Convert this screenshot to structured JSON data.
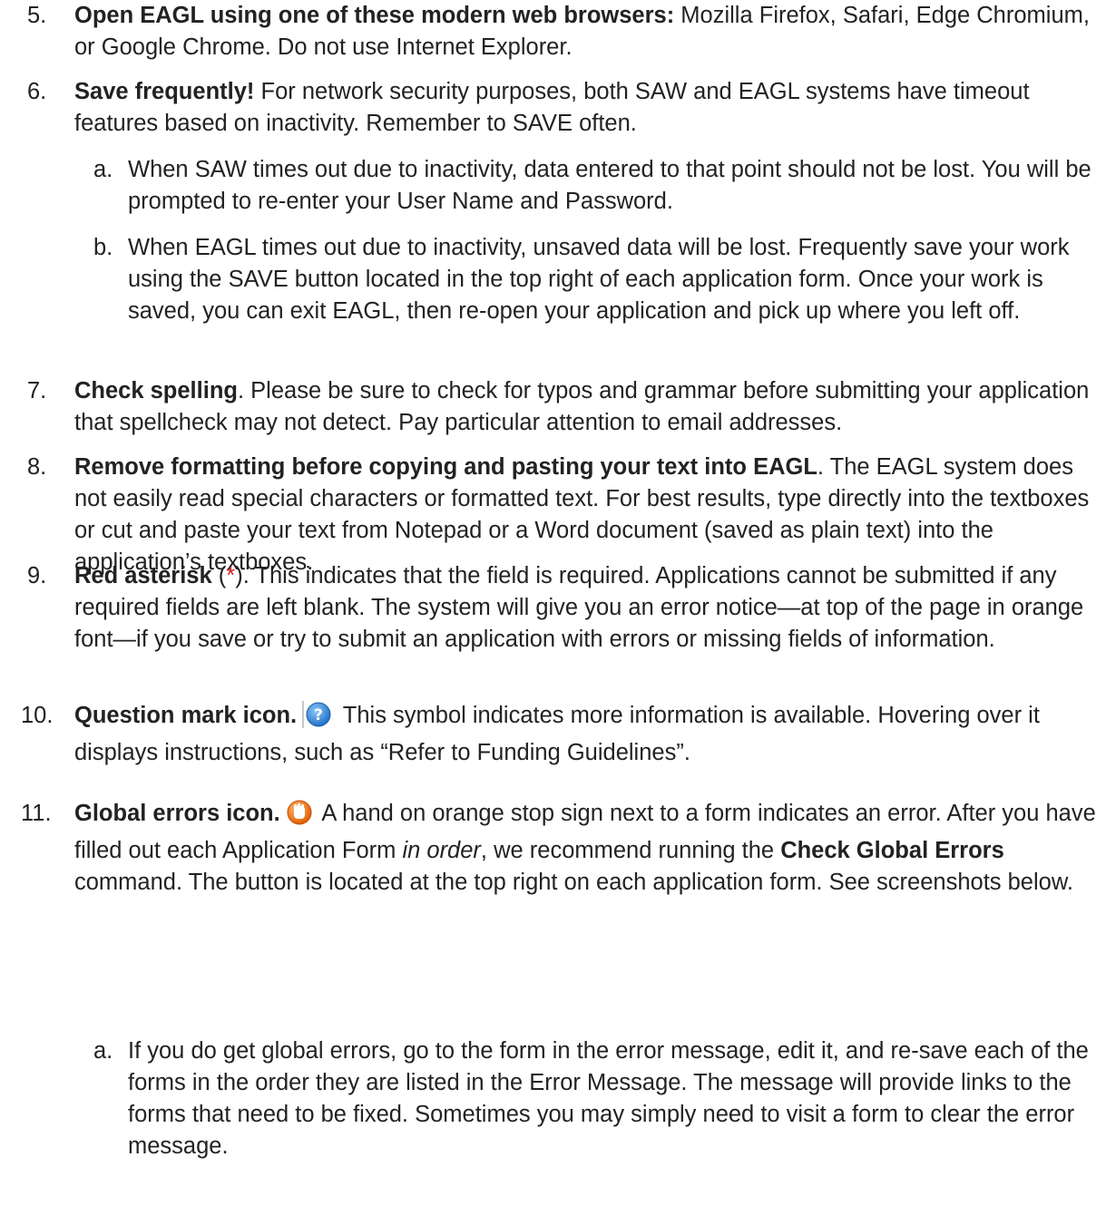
{
  "items": {
    "i5": {
      "num": "5.",
      "bold": "Open EAGL using one of these modern web browsers:",
      "text": " Mozilla Firefox, Safari, Edge Chromium, or Google Chrome. Do not use Internet Explorer."
    },
    "i6": {
      "num": "6.",
      "bold": "Save frequently!",
      "text": " For network security purposes, both SAW and EAGL systems have timeout features based on inactivity. Remember to SAVE often.",
      "a": {
        "letter": "a.",
        "text": "When SAW times out due to inactivity, data entered to that point should not be lost. You will be prompted to re-enter your User Name and Password."
      },
      "b": {
        "letter": "b.",
        "text": "When EAGL times out due to inactivity, unsaved data will be lost. Frequently save your work using the SAVE button located in the top right of each application form. Once your work is saved, you can exit EAGL, then re-open your application and pick up where you left off."
      }
    },
    "i7": {
      "num": "7.",
      "bold": "Check spelling",
      "text": ". Please be sure to check for typos and grammar before submitting your application that spellcheck may not detect. Pay particular attention to email addresses."
    },
    "i8": {
      "num": "8.",
      "bold": "Remove formatting before copying and pasting your text into EAGL",
      "text": ". The EAGL system does not easily read special characters or formatted text. For best results, type directly into the textboxes or cut and paste your text from Notepad or a Word document (saved as plain text) into the application’s textboxes."
    },
    "i9": {
      "num": "9.",
      "bold": "Red asterisk",
      "paren_open": " (",
      "asterisk": "*",
      "paren_close": ")",
      "text": ". This indicates that the field is required. Applications cannot be submitted if any required fields are left blank. The system will give you an error notice—at top of the page in orange font—if you save or try to submit an application with errors or missing fields of information."
    },
    "i10": {
      "num": "10.",
      "bold": "Question mark icon.",
      "icon": "question-mark-icon",
      "text": " This symbol indicates more information is available. Hovering over it displays instructions, such as “Refer to Funding Guidelines”."
    },
    "i11": {
      "num": "11.",
      "bold": "Global errors icon.",
      "icon": "stop-hand-icon",
      "text1": " A hand on orange stop sign next to a form indicates an error. After you have filled out each Application Form ",
      "italic": "in order",
      "text2": ", we recommend running the ",
      "bold2": "Check Global Errors",
      "text3": " command. The button is located at the top right on each application form. See screenshots below.",
      "a": {
        "letter": "a.",
        "text": "If you do get global errors, go to the form in the error message, edit it, and re-save each of the forms in the order they are listed in the Error Message. The message will provide links to the forms that need to be fixed. Sometimes you may simply need to visit a form to clear the error message."
      }
    }
  },
  "colors": {
    "text": "#222222",
    "asterisk": "#d81e1e",
    "question_icon": "#2f86d6",
    "stop_icon": "#f07a1a"
  }
}
